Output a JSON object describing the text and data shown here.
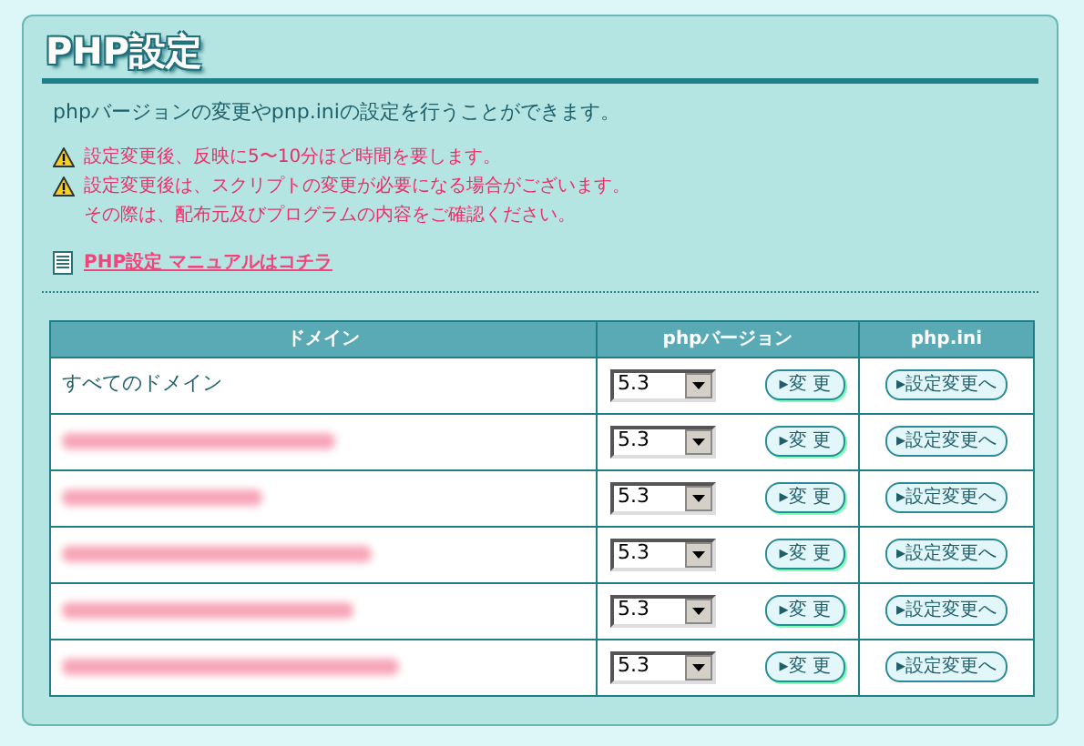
{
  "title": "PHP設定",
  "description": "phpバージョンの変更やpnp.iniの設定を行うことができます。",
  "notices": [
    {
      "text": "設定変更後、反映に5〜10分ほど時間を要します。",
      "kind": "warning"
    },
    {
      "text": "設定変更後は、スクリプトの変更が必要になる場合がございます。",
      "kind": "warning"
    },
    {
      "text": "その際は、配布元及びプログラムの内容をご確認ください。",
      "kind": "continuation"
    }
  ],
  "manual_link": "PHP設定 マニュアルはコチラ",
  "table": {
    "columns": [
      "ドメイン",
      "phpバージョン",
      "php.ini"
    ],
    "rows": [
      {
        "kind": "text",
        "domain": "すべてのドメイン",
        "version": "5.3",
        "change_button": "▸変 更",
        "ini_button": "▸設定変更へ"
      },
      {
        "kind": "redacted",
        "version": "5.3",
        "change_button": "▸変 更",
        "ini_button": "▸設定変更へ"
      },
      {
        "kind": "redacted",
        "version": "5.3",
        "change_button": "▸変 更",
        "ini_button": "▸設定変更へ"
      },
      {
        "kind": "redacted",
        "version": "5.3",
        "change_button": "▸変 更",
        "ini_button": "▸設定変更へ"
      },
      {
        "kind": "redacted",
        "version": "5.3",
        "change_button": "▸変 更",
        "ini_button": "▸設定変更へ"
      },
      {
        "kind": "redacted",
        "version": "5.3",
        "change_button": "▸変 更",
        "ini_button": "▸設定変更へ"
      }
    ]
  }
}
